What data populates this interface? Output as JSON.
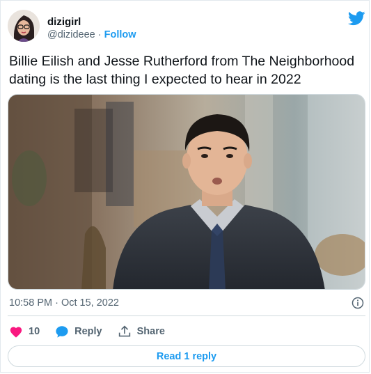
{
  "author": {
    "display_name": "dizigirl",
    "handle": "@dizideee",
    "separator": "·",
    "follow_label": "Follow"
  },
  "tweet": {
    "text": "Billie Eilish and Jesse Rutherford from The Neighborhood dating is the last thing I expected to hear in 2022",
    "timestamp": "10:58 PM · Oct 15, 2022"
  },
  "actions": {
    "likes_count": "10",
    "reply_label": "Reply",
    "share_label": "Share"
  },
  "read_replies_label": "Read 1 reply",
  "colors": {
    "accent": "#1d9bf0",
    "heart": "#f91880",
    "muted": "#536471"
  },
  "icons": [
    "twitter-bird-icon",
    "info-icon",
    "heart-icon",
    "reply-bubble-icon",
    "share-icon"
  ]
}
